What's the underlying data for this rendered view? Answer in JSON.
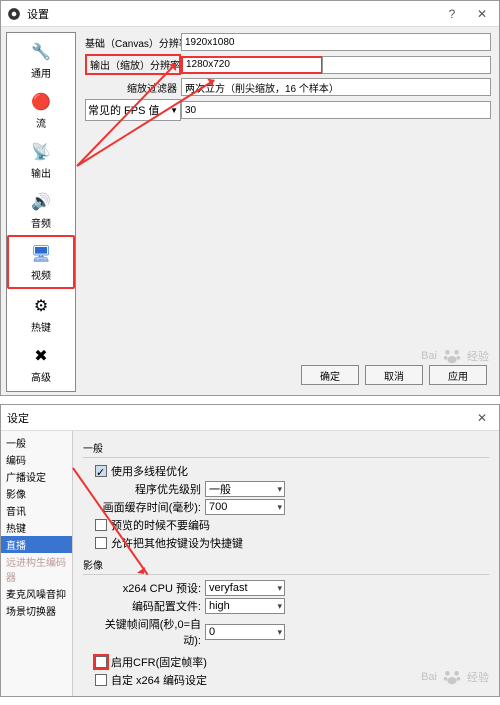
{
  "window1": {
    "title": "设置",
    "sidebar": [
      {
        "label": "通用",
        "icon": "🔧"
      },
      {
        "label": "流",
        "icon": "🔴"
      },
      {
        "label": "输出",
        "icon": "📡"
      },
      {
        "label": "音频",
        "icon": "🔊"
      },
      {
        "label": "视频",
        "icon": "🖥"
      },
      {
        "label": "热键",
        "icon": "⚙"
      },
      {
        "label": "高级",
        "icon": "✖"
      }
    ],
    "rows": {
      "base_label": "基础（Canvas）分辨率",
      "base_value": "1920x1080",
      "out_label": "输出（缩放）分辨率",
      "out_value": "1280x720",
      "filter_label": "缩放过滤器",
      "filter_value": "两次立方（削尖缩放，16 个样本）",
      "fps_label": "常见的 FPS 值",
      "fps_value": "30"
    },
    "buttons": {
      "ok": "确定",
      "cancel": "取消",
      "apply": "应用"
    }
  },
  "window2": {
    "title": "设定",
    "side": [
      "一般",
      "编码",
      "广播设定",
      "影像",
      "音讯",
      "热键",
      "直播",
      "远进构生编码器",
      "麦克风噪音抑",
      "场景切换器"
    ],
    "side_selected": "直播",
    "general": {
      "title": "一般",
      "multithread": "使用多线程优化",
      "priority_label": "程序优先级别",
      "priority_value": "一般",
      "buffer_label": "画面缓存时间(毫秒):",
      "buffer_value": "700",
      "preview_skip": "预览的时候不要编码",
      "allow_hotkey": "允许把其他按键设为快捷键"
    },
    "video": {
      "title": "影像",
      "preset_label": "x264 CPU 预设:",
      "preset_value": "veryfast",
      "profile_label": "编码配置文件:",
      "profile_value": "high",
      "keyframe_label": "关键帧间隔(秒,0=自动):",
      "keyframe_value": "0",
      "cfr": "启用CFR(固定帧率)",
      "custom": "自定 x264 编码设定"
    }
  },
  "watermark": {
    "brand": "Bai",
    "brand2": "经验"
  }
}
